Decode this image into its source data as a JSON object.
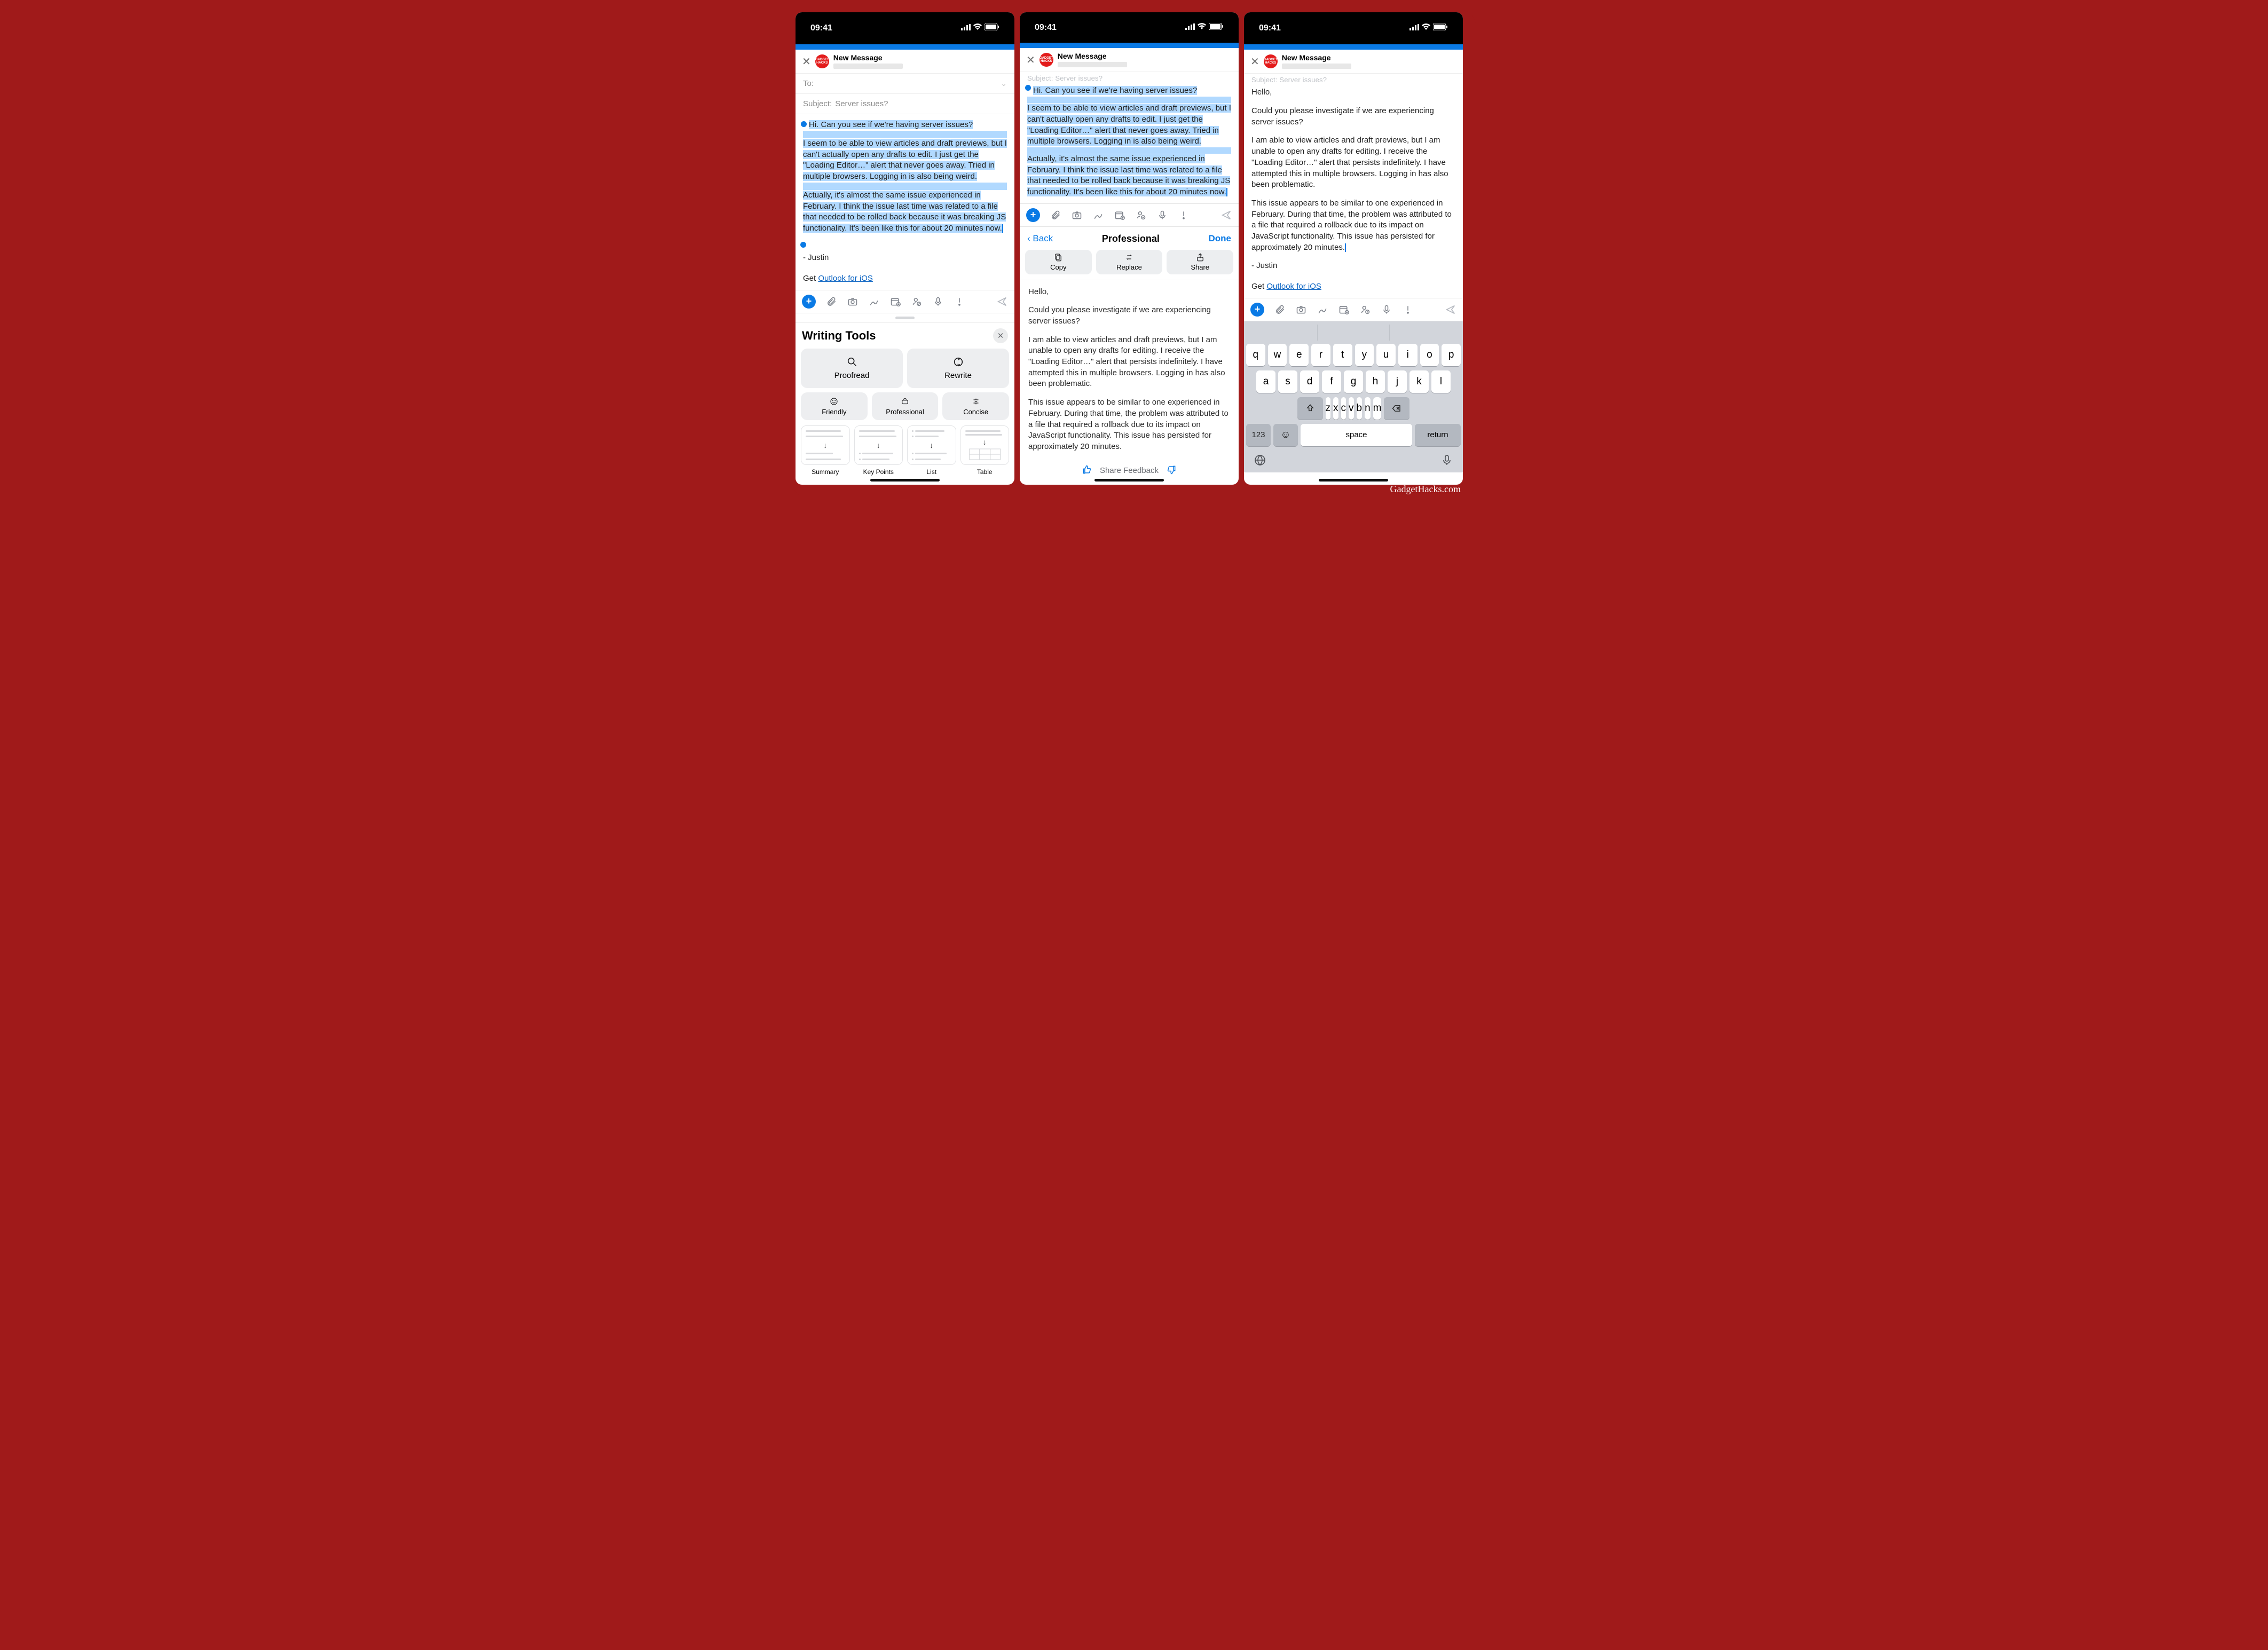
{
  "watermark": "GadgetHacks.com",
  "status": {
    "time": "09:41"
  },
  "compose": {
    "title": "New Message",
    "to_label": "To:",
    "subject_label": "Subject:",
    "subject_value": "Server issues?",
    "subject_faded": "Subject: Server issues?"
  },
  "email_original": {
    "p1": "Hi. Can you see if we're having server issues?",
    "p2": "I seem to be able to view articles and draft previews, but I can't actually open any drafts to edit. I just get the \"Loading Editor…\" alert that never goes away. Tried in multiple browsers. Logging in is also being weird.",
    "p3": "Actually, it's almost the same issue experienced in February. I think the issue last time was related to a file that needed to be rolled back because it was breaking JS functionality. It's been like this for about 20 minutes now.",
    "sig": "- Justin",
    "get": "Get ",
    "link": "Outlook for iOS"
  },
  "email_rewritten": {
    "p1": "Hello,",
    "p2": "Could you please investigate if we are experiencing server issues?",
    "p3": "I am able to view articles and draft previews, but I am unable to open any drafts for editing. I receive the \"Loading Editor…\" alert that persists indefinitely. I have attempted this in multiple browsers. Logging in has also been problematic.",
    "p4": "This issue appears to be similar to one experienced in February. During that time, the problem was attributed to a file that required a rollback due to its impact on JavaScript functionality. This issue has persisted for approximately 20 minutes.",
    "sig": "- Justin"
  },
  "writing_tools": {
    "title": "Writing Tools",
    "proofread": "Proofread",
    "rewrite": "Rewrite",
    "friendly": "Friendly",
    "professional": "Professional",
    "concise": "Concise",
    "summary": "Summary",
    "keypoints": "Key Points",
    "list": "List",
    "table": "Table"
  },
  "result_panel": {
    "back": "Back",
    "title": "Professional",
    "done": "Done",
    "copy": "Copy",
    "replace": "Replace",
    "share": "Share",
    "feedback": "Share Feedback"
  },
  "keyboard": {
    "row1": [
      "q",
      "w",
      "e",
      "r",
      "t",
      "y",
      "u",
      "i",
      "o",
      "p"
    ],
    "row2": [
      "a",
      "s",
      "d",
      "f",
      "g",
      "h",
      "j",
      "k",
      "l"
    ],
    "row3": [
      "z",
      "x",
      "c",
      "v",
      "b",
      "n",
      "m"
    ],
    "num": "123",
    "space": "space",
    "return": "return"
  }
}
